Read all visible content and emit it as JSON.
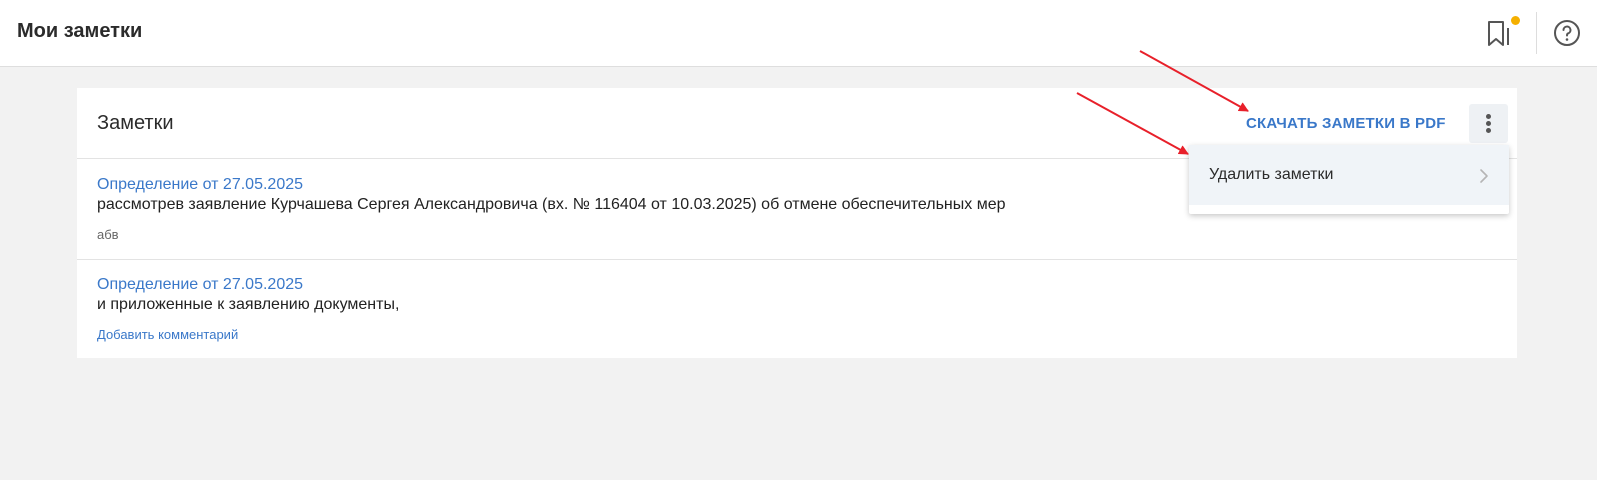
{
  "header": {
    "title": "Мои заметки",
    "bookmark_icon": "bookmark-icon",
    "help_icon": "help-circle-icon",
    "notification_color": "#f5b000"
  },
  "card": {
    "title": "Заметки",
    "download_label": "СКАЧАТЬ ЗАМЕТКИ В PDF",
    "more_icon": "more-vertical-icon"
  },
  "notes": [
    {
      "link": "Определение от 27.05.2025",
      "text": "рассмотрев заявление Курчашева Сергея Александровича (вх. № 116404 от 10.03.2025) об отмене обеспечительных мер",
      "comment": "абв"
    },
    {
      "link": "Определение от 27.05.2025",
      "text": "и приложенные к заявлению документы,",
      "add_comment": "Добавить комментарий"
    }
  ],
  "dropdown": {
    "items": [
      {
        "label": "Удалить заметки",
        "icon": "chevron-right-icon"
      }
    ]
  },
  "colors": {
    "accent": "#3a78c9",
    "annotation_arrow": "#e8202a",
    "background": "#f2f2f2"
  }
}
